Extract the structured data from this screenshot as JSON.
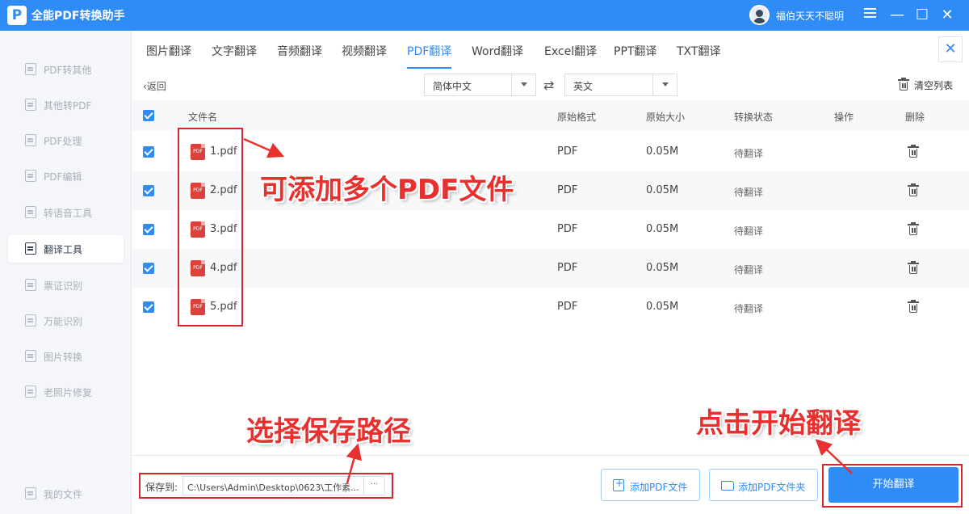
{
  "app": {
    "logo_letter": "P",
    "title": "全能PDF转换助手",
    "username": "福伯天天不聪明"
  },
  "colors": {
    "accent": "#2f8bf5",
    "annotation": "#e8312f",
    "file_icon": "#e0403c"
  },
  "sidebar": {
    "items": [
      {
        "label": "PDF转其他",
        "active": false
      },
      {
        "label": "其他转PDF",
        "active": false
      },
      {
        "label": "PDF处理",
        "active": false
      },
      {
        "label": "PDF编辑",
        "active": false
      },
      {
        "label": "转语音工具",
        "active": false
      },
      {
        "label": "翻译工具",
        "active": true
      },
      {
        "label": "票证识别",
        "active": false
      },
      {
        "label": "万能识别",
        "active": false
      },
      {
        "label": "图片转换",
        "active": false
      },
      {
        "label": "老照片修复",
        "active": false
      }
    ],
    "footer": {
      "label": "我的文件"
    }
  },
  "tabs": [
    {
      "label": "图片翻译"
    },
    {
      "label": "文字翻译"
    },
    {
      "label": "音频翻译"
    },
    {
      "label": "视频翻译"
    },
    {
      "label": "PDF翻译",
      "active": true
    },
    {
      "label": "Word翻译"
    },
    {
      "label": "Excel翻译"
    },
    {
      "label": "PPT翻译"
    },
    {
      "label": "TXT翻译"
    }
  ],
  "toolbar": {
    "back": "返回",
    "source_lang": "简体中文",
    "target_lang": "英文",
    "clear_list": "清空列表"
  },
  "table": {
    "headers": {
      "name": "文件名",
      "format": "原始格式",
      "size": "原始大小",
      "status": "转换状态",
      "action": "操作",
      "delete": "删除"
    },
    "rows": [
      {
        "name": "1.pdf",
        "format": "PDF",
        "size": "0.05M",
        "status": "待翻译"
      },
      {
        "name": "2.pdf",
        "format": "PDF",
        "size": "0.05M",
        "status": "待翻译"
      },
      {
        "name": "3.pdf",
        "format": "PDF",
        "size": "0.05M",
        "status": "待翻译"
      },
      {
        "name": "4.pdf",
        "format": "PDF",
        "size": "0.05M",
        "status": "待翻译"
      },
      {
        "name": "5.pdf",
        "format": "PDF",
        "size": "0.05M",
        "status": "待翻译"
      }
    ],
    "file_icon_text": "PDF"
  },
  "bottom": {
    "save_label": "保存到:",
    "save_path": "C:\\Users\\Admin\\Desktop\\0623\\工作素...",
    "browse": "···",
    "add_file": "添加PDF文件",
    "add_folder": "添加PDF文件夹",
    "start": "开始翻译"
  },
  "annotations": {
    "add_files": "可添加多个PDF文件",
    "choose_path": "选择保存路径",
    "click_start": "点击开始翻译"
  }
}
